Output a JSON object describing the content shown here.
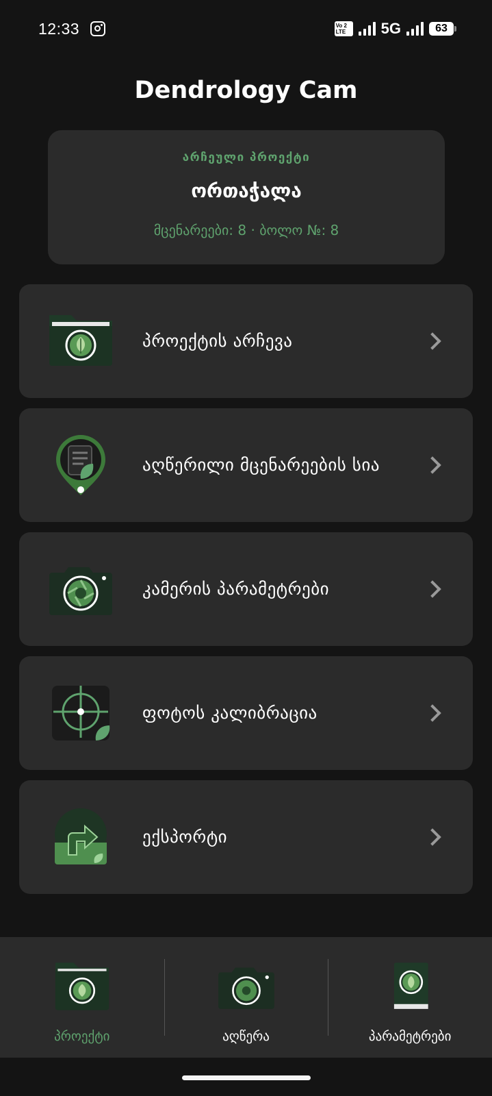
{
  "status_bar": {
    "time": "12:33",
    "network": "5G",
    "battery": "63",
    "volte_top": "Vo 2",
    "volte_bottom": "LTE",
    "icons": [
      "instagram-icon",
      "volte-icon",
      "signal-icon",
      "signal-icon",
      "battery-icon"
    ]
  },
  "app": {
    "title": "Dendrology Cam"
  },
  "project": {
    "caption": "არჩეული პროექტი",
    "name": "ორთაჭალა",
    "stats": "მცენარეები: 8 · ბოლო №: 8"
  },
  "menu": {
    "items": [
      {
        "label": "პროექტის არჩევა",
        "icon": "folder-leaf-icon"
      },
      {
        "label": "აღწერილი მცენარეების სია",
        "icon": "list-pin-leaf-icon"
      },
      {
        "label": "კამერის პარამეტრები",
        "icon": "camera-icon"
      },
      {
        "label": "ფოტოს კალიბრაცია",
        "icon": "crosshair-leaf-icon"
      },
      {
        "label": "ექსპორტი",
        "icon": "export-arrow-icon"
      }
    ]
  },
  "bottom_nav": {
    "tabs": [
      {
        "label": "პროექტი",
        "icon": "folder-leaf-icon",
        "active": true
      },
      {
        "label": "აღწერა",
        "icon": "camera-icon",
        "active": false
      },
      {
        "label": "პარამეტრები",
        "icon": "book-leaf-icon",
        "active": false
      }
    ]
  },
  "colors": {
    "background": "#141414",
    "card": "#2b2b2b",
    "accent_green": "#5fa36e",
    "chevron": "#9a9a9a"
  }
}
